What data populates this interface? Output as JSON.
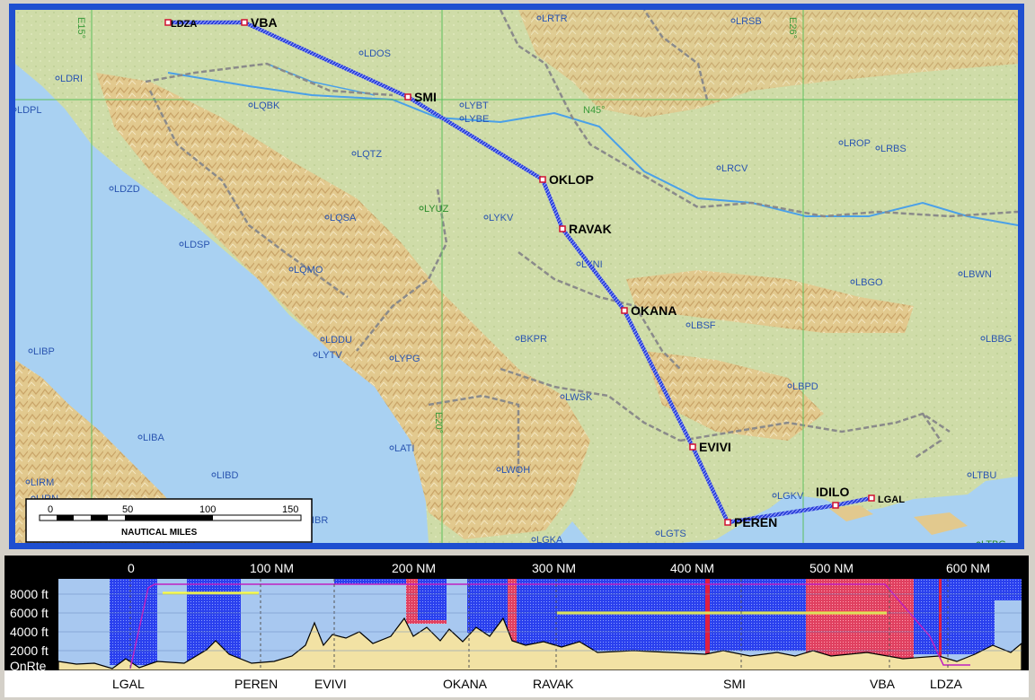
{
  "colors": {
    "sea": "#a8d0f0",
    "land": "#e6d4a3",
    "route": "#3346d6",
    "waypoint": "#d01030",
    "profile_sky": "#a8c8f0",
    "profile_terrain": "#f0e0a0",
    "profile_block": "#2244ee",
    "profile_red": "#e04060",
    "profile_line": "#c020c0",
    "profile_yellow": "#ffff40"
  },
  "map": {
    "grid_labels": [
      {
        "id": "e15",
        "text": "E15°"
      },
      {
        "id": "e20",
        "text": "E20°"
      },
      {
        "id": "e26",
        "text": "E26°"
      },
      {
        "id": "n45",
        "text": "N45°"
      }
    ],
    "airports": [
      {
        "id": "lrtr",
        "text": "LRTR"
      },
      {
        "id": "lrsb",
        "text": "LRSB"
      },
      {
        "id": "ldos",
        "text": "LDOS"
      },
      {
        "id": "ldri",
        "text": "LDRI"
      },
      {
        "id": "ldpl",
        "text": "LDPL"
      },
      {
        "id": "lqbk",
        "text": "LQBK"
      },
      {
        "id": "lybt",
        "text": "LYBT"
      },
      {
        "id": "lybe",
        "text": "LYBE"
      },
      {
        "id": "lrop",
        "text": "LROP"
      },
      {
        "id": "lrbs",
        "text": "LRBS"
      },
      {
        "id": "lqtz",
        "text": "LQTZ"
      },
      {
        "id": "lrcv",
        "text": "LRCV"
      },
      {
        "id": "ldzd",
        "text": "LDZD"
      },
      {
        "id": "lyuz",
        "text": "LYUZ"
      },
      {
        "id": "lqsa",
        "text": "LQSA"
      },
      {
        "id": "lykv",
        "text": "LYKV"
      },
      {
        "id": "ldsp",
        "text": "LDSP"
      },
      {
        "id": "lyni",
        "text": "LYNI"
      },
      {
        "id": "lqmo",
        "text": "LQMO"
      },
      {
        "id": "lbwn",
        "text": "LBWN"
      },
      {
        "id": "lbgo",
        "text": "LBGO"
      },
      {
        "id": "lbsf",
        "text": "LBSF"
      },
      {
        "id": "lddu",
        "text": "LDDU"
      },
      {
        "id": "lytv",
        "text": "LYTV"
      },
      {
        "id": "bkpr",
        "text": "BKPR"
      },
      {
        "id": "lbbg",
        "text": "LBBG"
      },
      {
        "id": "libp",
        "text": "LIBP"
      },
      {
        "id": "lypg",
        "text": "LYPG"
      },
      {
        "id": "lbpd",
        "text": "LBPD"
      },
      {
        "id": "lwsk",
        "text": "LWSK"
      },
      {
        "id": "liba",
        "text": "LIBA"
      },
      {
        "id": "lati",
        "text": "LATI"
      },
      {
        "id": "lwoh",
        "text": "LWOH"
      },
      {
        "id": "ltbu",
        "text": "LTBU"
      },
      {
        "id": "libd",
        "text": "LIBD"
      },
      {
        "id": "lirm",
        "text": "LIRM"
      },
      {
        "id": "lirn",
        "text": "LIRN"
      },
      {
        "id": "lgkv",
        "text": "LGKV"
      },
      {
        "id": "ibr",
        "text": "IBR"
      },
      {
        "id": "lgka",
        "text": "LGKA"
      },
      {
        "id": "lgts",
        "text": "LGTS"
      },
      {
        "id": "ltbg",
        "text": "LTBG"
      }
    ],
    "waypoints": [
      {
        "id": "ldza",
        "text": "LDZA"
      },
      {
        "id": "vba",
        "text": "VBA"
      },
      {
        "id": "smi",
        "text": "SMI"
      },
      {
        "id": "oklop",
        "text": "OKLOP"
      },
      {
        "id": "ravak",
        "text": "RAVAK"
      },
      {
        "id": "okana",
        "text": "OKANA"
      },
      {
        "id": "evivi",
        "text": "EVIVI"
      },
      {
        "id": "peren",
        "text": "PEREN"
      },
      {
        "id": "idilo",
        "text": "IDILO"
      },
      {
        "id": "lgal",
        "text": "LGAL"
      }
    ],
    "scale": {
      "ticks": [
        "0",
        "50",
        "100",
        "150"
      ],
      "unit": "NAUTICAL MILES"
    }
  },
  "profile": {
    "distance_ticks": [
      "0",
      "100 NM",
      "200 NM",
      "300 NM",
      "400 NM",
      "500 NM",
      "600 NM"
    ],
    "altitude_labels": [
      "8000 ft",
      "6000 ft",
      "4000 ft",
      "2000 ft",
      "OnRte"
    ],
    "waypoint_labels": [
      "LGAL",
      "PEREN",
      "EVIVI",
      "OKANA",
      "RAVAK",
      "SMI",
      "VBA",
      "LDZA"
    ]
  }
}
